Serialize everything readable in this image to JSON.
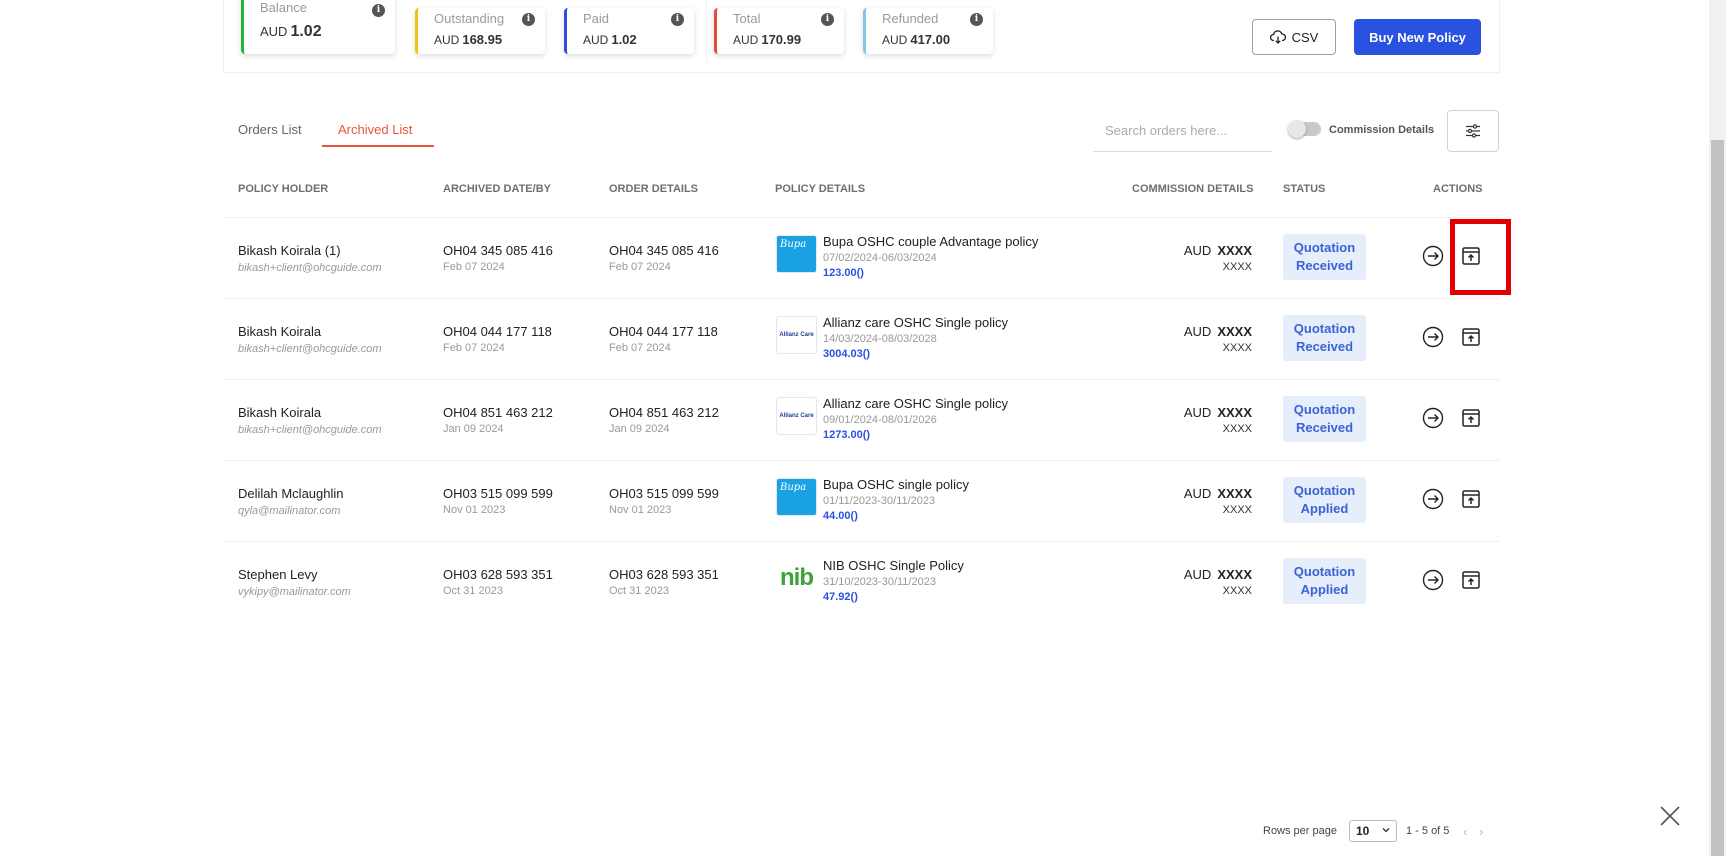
{
  "summary": {
    "currency": "AUD",
    "balance": {
      "label": "Balance",
      "value": "1.02"
    },
    "outstanding": {
      "label": "Outstanding",
      "value": "168.95"
    },
    "paid": {
      "label": "Paid",
      "value": "1.02"
    },
    "total": {
      "label": "Total",
      "value": "170.99"
    },
    "refunded": {
      "label": "Refunded",
      "value": "417.00"
    }
  },
  "toolbar": {
    "csv_label": "CSV",
    "buy_label": "Buy New Policy"
  },
  "tabs": [
    {
      "label": "Orders List",
      "active": false
    },
    {
      "label": "Archived List",
      "active": true
    }
  ],
  "search": {
    "placeholder": "Search orders here..."
  },
  "commission_toggle": {
    "label": "Commission Details",
    "on": false
  },
  "columns": {
    "holder": "POLICY HOLDER",
    "archived": "ARCHIVED DATE/BY",
    "order": "ORDER DETAILS",
    "policy": "POLICY DETAILS",
    "commission": "COMMISSION DETAILS",
    "status": "STATUS",
    "actions": "ACTIONS"
  },
  "rows": [
    {
      "name": "Bikash Koirala (1)",
      "email": "bikash+client@ohcguide.com",
      "archived_no": "OH04 345 085 416",
      "archived_date": "Feb 07 2024",
      "order_no": "OH04 345 085 416",
      "order_date": "Feb 07 2024",
      "logo": "Bupa",
      "policy_title": "Bupa OSHC couple Advantage policy",
      "policy_dates": "07/02/2024-06/03/2024",
      "policy_amount": "123.00()",
      "comm_currency": "AUD",
      "comm_value": "XXXX",
      "comm_sub": "XXXX",
      "status_line1": "Quotation",
      "status_line2": "Received"
    },
    {
      "name": "Bikash Koirala",
      "email": "bikash+client@ohcguide.com",
      "archived_no": "OH04 044 177 118",
      "archived_date": "Feb 07 2024",
      "order_no": "OH04 044 177 118",
      "order_date": "Feb 07 2024",
      "logo": "Allianz Care",
      "policy_title": "Allianz care OSHC Single policy",
      "policy_dates": "14/03/2024-08/03/2028",
      "policy_amount": "3004.03()",
      "comm_currency": "AUD",
      "comm_value": "XXXX",
      "comm_sub": "XXXX",
      "status_line1": "Quotation",
      "status_line2": "Received"
    },
    {
      "name": "Bikash Koirala",
      "email": "bikash+client@ohcguide.com",
      "archived_no": "OH04 851 463 212",
      "archived_date": "Jan 09 2024",
      "order_no": "OH04 851 463 212",
      "order_date": "Jan 09 2024",
      "logo": "Allianz Care",
      "policy_title": "Allianz care OSHC Single policy",
      "policy_dates": "09/01/2024-08/01/2026",
      "policy_amount": "1273.00()",
      "comm_currency": "AUD",
      "comm_value": "XXXX",
      "comm_sub": "XXXX",
      "status_line1": "Quotation",
      "status_line2": "Received"
    },
    {
      "name": "Delilah Mclaughlin",
      "email": "qyla@mailinator.com",
      "archived_no": "OH03 515 099 599",
      "archived_date": "Nov 01 2023",
      "order_no": "OH03 515 099 599",
      "order_date": "Nov 01 2023",
      "logo": "Bupa",
      "policy_title": "Bupa OSHC single policy",
      "policy_dates": "01/11/2023-30/11/2023",
      "policy_amount": "44.00()",
      "comm_currency": "AUD",
      "comm_value": "XXXX",
      "comm_sub": "XXXX",
      "status_line1": "Quotation",
      "status_line2": "Applied"
    },
    {
      "name": "Stephen Levy",
      "email": "vykipy@mailinator.com",
      "archived_no": "OH03 628 593 351",
      "archived_date": "Oct 31 2023",
      "order_no": "OH03 628 593 351",
      "order_date": "Oct 31 2023",
      "logo": "nib",
      "policy_title": "NIB OSHC Single Policy",
      "policy_dates": "31/10/2023-30/11/2023",
      "policy_amount": "47.92()",
      "comm_currency": "AUD",
      "comm_value": "XXXX",
      "comm_sub": "XXXX",
      "status_line1": "Quotation",
      "status_line2": "Applied"
    }
  ],
  "pagination": {
    "rows_label": "Rows per page",
    "rows_value": "10",
    "range": "1 - 5 of 5"
  },
  "icons": {
    "info": "info-icon",
    "csv": "cloud-download-icon",
    "filter": "sliders-icon",
    "view": "arrow-right-circle-icon",
    "unarchive": "unarchive-box-icon",
    "close": "close-icon"
  },
  "colors": {
    "primary": "#2a52e0",
    "accent_tab": "#e8553a",
    "balance": "#27b33a",
    "outstanding": "#f2c40f",
    "paid": "#2e4fd8",
    "total": "#e24c3a",
    "refunded": "#84c8e6",
    "status_bg": "#e6edfb",
    "highlight": "#e00000"
  }
}
